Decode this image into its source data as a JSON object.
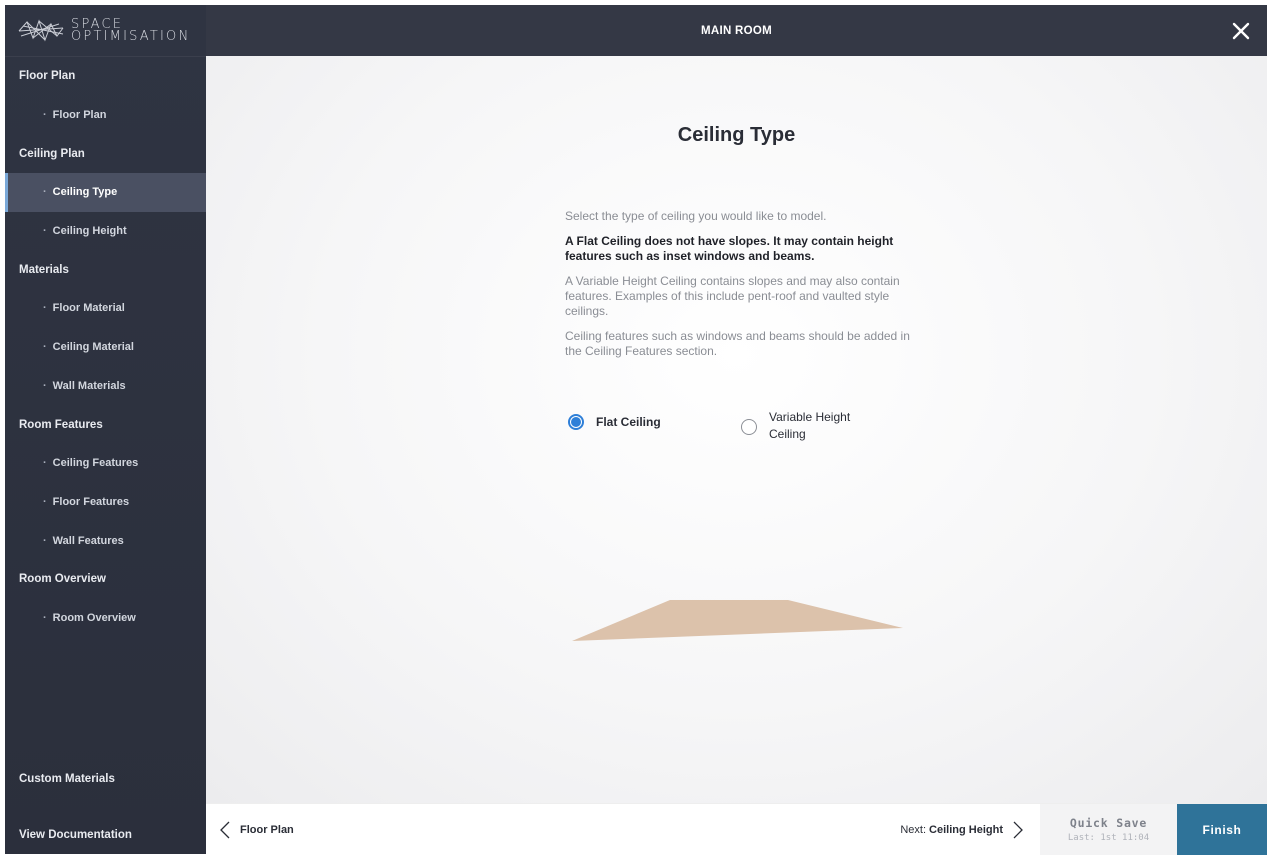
{
  "brand": {
    "line1": "SPACE",
    "line2": "OPTIMISATION"
  },
  "header": {
    "title": "MAIN ROOM"
  },
  "sidebar": {
    "sections": [
      {
        "label": "Floor Plan",
        "items": [
          {
            "label": "Floor Plan"
          }
        ]
      },
      {
        "label": "Ceiling Plan",
        "items": [
          {
            "label": "Ceiling Type",
            "active": true
          },
          {
            "label": "Ceiling Height"
          }
        ]
      },
      {
        "label": "Materials",
        "items": [
          {
            "label": "Floor Material"
          },
          {
            "label": "Ceiling Material"
          },
          {
            "label": "Wall Materials"
          }
        ]
      },
      {
        "label": "Room Features",
        "items": [
          {
            "label": "Ceiling Features"
          },
          {
            "label": "Floor Features"
          },
          {
            "label": "Wall Features"
          }
        ]
      },
      {
        "label": "Room Overview",
        "items": [
          {
            "label": "Room Overview"
          }
        ]
      }
    ],
    "bullet": "·",
    "custom_materials": "Custom Materials",
    "view_documentation": "View Documentation"
  },
  "main": {
    "title": "Ceiling Type",
    "intro": "Select the type of ceiling you would like to model.",
    "flat_desc": "A Flat Ceiling does not have slopes. It may contain height features such as inset windows and beams.",
    "variable_desc": "A Variable Height Ceiling contains slopes and may also contain features. Examples of this include pent-roof and vaulted style ceilings.",
    "features_note": "Ceiling features such as windows and beams should be added in the Ceiling Features section.",
    "options": [
      {
        "label": "Flat Ceiling",
        "selected": true
      },
      {
        "label_line1": "Variable Height",
        "label_line2": "Ceiling",
        "selected": false
      }
    ],
    "preview_color": "#dcc2ab"
  },
  "footer": {
    "prev_label": "Floor Plan",
    "next_prefix": "Next:",
    "next_label": "Ceiling Height",
    "quick_save": "Quick Save",
    "last_saved": "Last: 1st 11:04",
    "finish": "Finish"
  },
  "icons": {
    "logo": "space-optimisation-logo",
    "close": "close-icon",
    "prev": "chevron-left-icon",
    "next": "chevron-right-icon"
  }
}
